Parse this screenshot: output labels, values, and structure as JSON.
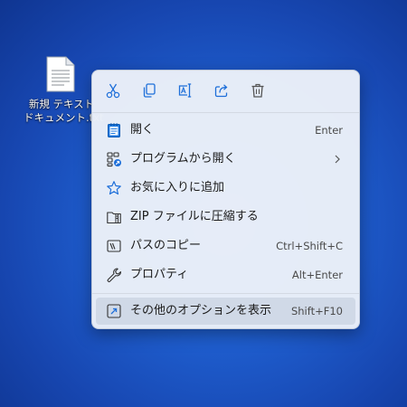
{
  "desktop": {
    "file": {
      "name_line1": "新規 テキスト",
      "name_line2": "ドキュメント.txt",
      "icon": "text-document-icon"
    }
  },
  "context_menu": {
    "quick_actions": [
      {
        "name": "cut",
        "icon": "scissors-icon"
      },
      {
        "name": "copy",
        "icon": "copy-icon"
      },
      {
        "name": "rename",
        "icon": "rename-icon"
      },
      {
        "name": "share",
        "icon": "share-icon"
      },
      {
        "name": "delete",
        "icon": "trash-icon"
      }
    ],
    "items": [
      {
        "label": "開く",
        "shortcut": "Enter",
        "icon": "notepad-icon"
      },
      {
        "label": "プログラムから開く",
        "shortcut": "",
        "icon": "open-with-icon",
        "has_submenu": true
      },
      {
        "label": "お気に入りに追加",
        "shortcut": "",
        "icon": "star-icon"
      },
      {
        "label": "ZIP ファイルに圧縮する",
        "shortcut": "",
        "icon": "zip-folder-icon"
      },
      {
        "label": "パスのコピー",
        "shortcut": "Ctrl+Shift+C",
        "icon": "copy-path-icon"
      },
      {
        "label": "プロパティ",
        "shortcut": "Alt+Enter",
        "icon": "wrench-icon"
      },
      {
        "label": "その他のオプションを表示",
        "shortcut": "Shift+F10",
        "icon": "more-options-icon"
      }
    ]
  },
  "colors": {
    "desktop_background": "#1f5fd0",
    "accent": "#1e6fd9",
    "menu_background": "#eaeff8",
    "highlight": "#cdd6e4"
  }
}
